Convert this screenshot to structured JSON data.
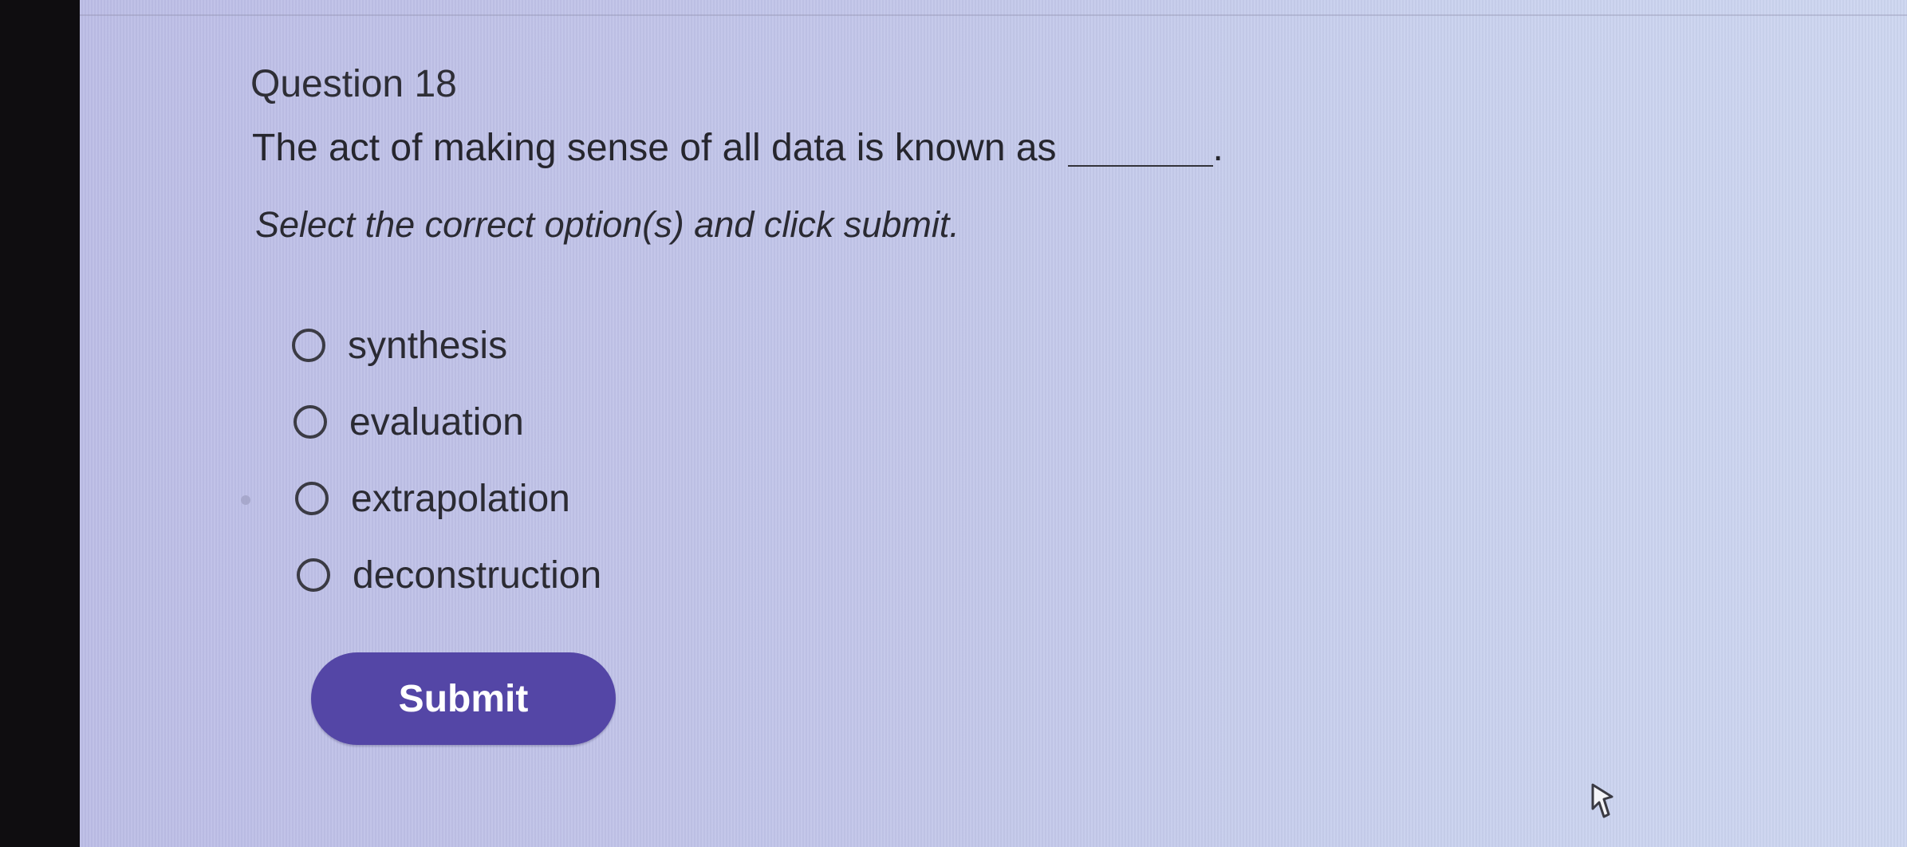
{
  "question": {
    "title": "Question 18",
    "text": "The act of making sense of all data is known as",
    "blank_suffix": "."
  },
  "instruction": "Select the correct option(s) and click submit.",
  "options": [
    {
      "label": "synthesis",
      "selected": false
    },
    {
      "label": "evaluation",
      "selected": false
    },
    {
      "label": "extrapolation",
      "selected": false
    },
    {
      "label": "deconstruction",
      "selected": false
    }
  ],
  "submit": {
    "label": "Submit"
  },
  "colors": {
    "background": "#c5c9ea",
    "text": "#2b2b33",
    "submit_button": "#5446a6",
    "submit_text": "#ffffff"
  },
  "icons": {
    "cursor": "pointer-cursor-icon"
  }
}
